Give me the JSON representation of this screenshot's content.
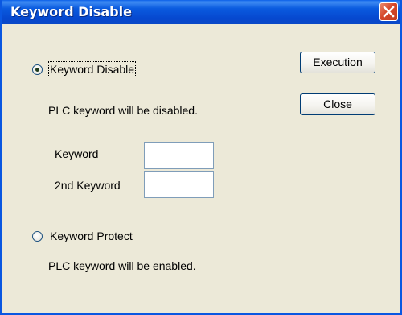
{
  "window": {
    "title": "Keyword Disable"
  },
  "options": {
    "disable": {
      "label": "Keyword Disable",
      "description": "PLC keyword will be disabled.",
      "selected": true
    },
    "protect": {
      "label": "Keyword Protect",
      "description": "PLC keyword will be enabled.",
      "selected": false
    }
  },
  "fields": {
    "keyword": {
      "label": "Keyword",
      "value": ""
    },
    "second_keyword": {
      "label": "2nd Keyword",
      "value": ""
    }
  },
  "buttons": {
    "execution": "Execution",
    "close": "Close"
  },
  "icons": {
    "close": "close-icon"
  },
  "colors": {
    "titlebar": "#0a5bdf",
    "dialog_bg": "#ece9d8",
    "close_button": "#d5472a"
  }
}
